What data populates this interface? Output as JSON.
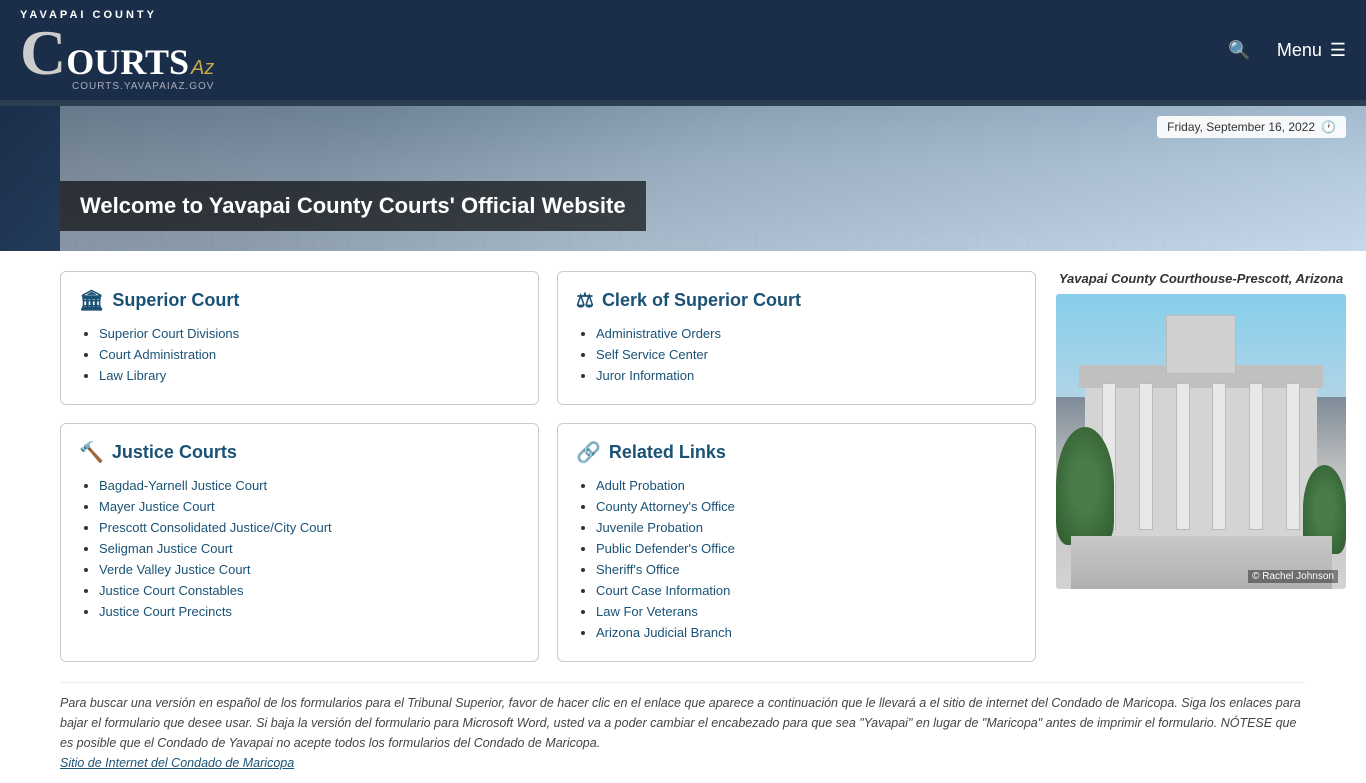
{
  "header": {
    "logo_yavapai": "YAVAPAI COUNTY",
    "logo_c": "C",
    "logo_ourts": "OURTS",
    "logo_az": "Az",
    "logo_subtitle": "COURTS.YAVAPAIAZ.GOV",
    "menu_label": "Menu",
    "search_icon": "🔍"
  },
  "hero": {
    "date": "Friday, September 16, 2022",
    "clock_icon": "🕐",
    "title": "Welcome to Yavapai County Courts' Official Website"
  },
  "superior_court": {
    "title": "Superior Court",
    "icon": "🏛",
    "links": [
      "Superior Court Divisions",
      "Court Administration",
      "Law Library"
    ]
  },
  "clerk_court": {
    "title": "Clerk of Superior Court",
    "icon": "⚖",
    "links": [
      "Administrative Orders",
      "Self Service Center",
      "Juror Information"
    ]
  },
  "justice_courts": {
    "title": "Justice Courts",
    "icon": "🔨",
    "links": [
      "Bagdad-Yarnell Justice Court",
      "Mayer Justice Court",
      "Prescott Consolidated Justice/City Court",
      "Seligman Justice Court",
      "Verde Valley Justice Court",
      "Justice Court Constables",
      "Justice Court Precincts"
    ]
  },
  "related_links": {
    "title": "Related Links",
    "icon": "🔗",
    "links": [
      "Adult Probation",
      "County Attorney's Office",
      "Juvenile Probation",
      "Public Defender's Office",
      "Sheriff's Office",
      "Court Case Information",
      "Law For Veterans",
      "Arizona Judicial Branch"
    ]
  },
  "sidebar": {
    "caption": "Yavapai County Courthouse-Prescott, Arizona",
    "photo_credit": "© Rachel Johnson"
  },
  "footer": {
    "text": "Para buscar una versión en español de los formularios para el Tribunal Superior, favor de hacer clic en el enlace que aparece a continuación que le llevará a el sitio de internet del Condado de Maricopa. Siga los enlaces para bajar el formulario que desee usar. Si baja la versión del formulario para Microsoft Word, usted va a poder cambiar el encabezado para que sea \"Yavapai\" en lugar de \"Maricopa\" antes de imprimir el formulario. NÓTESE que es posible que el Condado de Yavapai no acepte todos los formularios del Condado de Maricopa.",
    "link_text": "Sitio de Internet del Condado de Maricopa"
  }
}
